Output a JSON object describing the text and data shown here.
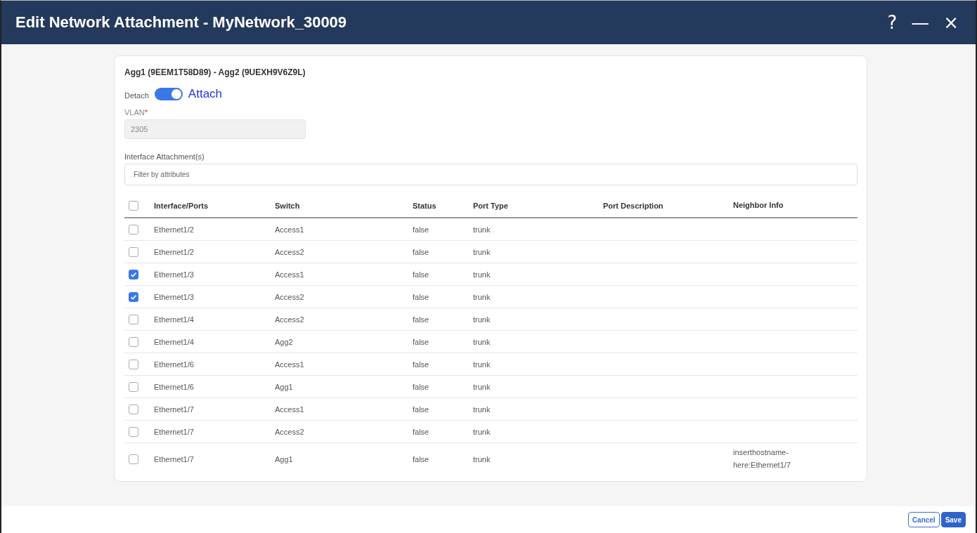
{
  "window": {
    "title": "Edit Network Attachment - MyNetwork_30009",
    "controls": [
      "?",
      "—",
      "×"
    ]
  },
  "pair_title": "Agg1 (9EEM1T58D89) - Agg2 (9UEXH9V6Z9L)",
  "toggle": {
    "off_label": "Detach",
    "on_label": "Attach",
    "on": true
  },
  "vlan": {
    "label": "VLAN",
    "required_mark": "*",
    "value": "2305",
    "disabled": true
  },
  "interfaces": {
    "label": "Interface Attachment(s)",
    "filter": {
      "placeholder": "Filter by attributes"
    },
    "select_all": {
      "checked": false
    },
    "columns": [
      "Interface/Ports",
      "Switch",
      "Status",
      "Port Type",
      "Port Description",
      "Neighbor Info"
    ],
    "rows": [
      {
        "checked": false,
        "cells": [
          "Ethernet1/2",
          "Access1",
          "false",
          "trunk",
          "",
          ""
        ]
      },
      {
        "checked": false,
        "cells": [
          "Ethernet1/2",
          "Access2",
          "false",
          "trunk",
          "",
          ""
        ]
      },
      {
        "checked": true,
        "cells": [
          "Ethernet1/3",
          "Access1",
          "false",
          "trunk",
          "",
          ""
        ]
      },
      {
        "checked": true,
        "cells": [
          "Ethernet1/3",
          "Access2",
          "false",
          "trunk",
          "",
          ""
        ]
      },
      {
        "checked": false,
        "cells": [
          "Ethernet1/4",
          "Access2",
          "false",
          "trunk",
          "",
          ""
        ]
      },
      {
        "checked": false,
        "cells": [
          "Ethernet1/4",
          "Agg2",
          "false",
          "trunk",
          "",
          ""
        ]
      },
      {
        "checked": false,
        "cells": [
          "Ethernet1/6",
          "Access1",
          "false",
          "trunk",
          "",
          ""
        ]
      },
      {
        "checked": false,
        "cells": [
          "Ethernet1/6",
          "Agg1",
          "false",
          "trunk",
          "",
          ""
        ]
      },
      {
        "checked": false,
        "cells": [
          "Ethernet1/7",
          "Access1",
          "false",
          "trunk",
          "",
          ""
        ]
      },
      {
        "checked": false,
        "cells": [
          "Ethernet1/7",
          "Access2",
          "false",
          "trunk",
          "",
          ""
        ]
      },
      {
        "checked": false,
        "cells": [
          "Ethernet1/7",
          "Agg1",
          "false",
          "trunk",
          "",
          "inserthostname-here:Ethernet1/7"
        ]
      }
    ]
  },
  "buttons": [
    {
      "label": "Cancel",
      "kind": "secondary"
    },
    {
      "label": "Save",
      "kind": "primary"
    }
  ]
}
